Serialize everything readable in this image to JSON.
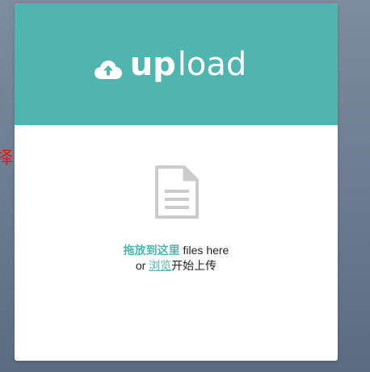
{
  "side_text": "择",
  "header": {
    "icon": "cloud-upload-icon",
    "title_bold": "up",
    "title_light": "load",
    "color": "#4fb5ae"
  },
  "dropzone": {
    "icon": "document-icon",
    "line1_highlight": "拖放到这里",
    "line1_rest": " files here",
    "line2_prefix": "or ",
    "browse_label": "浏览",
    "line2_suffix": "开始上传"
  }
}
